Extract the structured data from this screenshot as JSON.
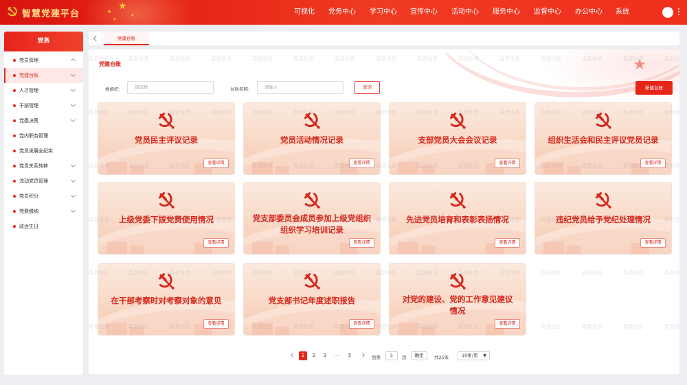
{
  "app": {
    "title": "智慧党建平台",
    "logo_icon": "hammer-sickle-icon",
    "brand_color": "#e7261a"
  },
  "nav": [
    "可视化",
    "党务中心",
    "学习中心",
    "宣传中心",
    "活动中心",
    "服务中心",
    "监督中心",
    "办公中心",
    "系统"
  ],
  "sidebar": {
    "header": "党务",
    "items": [
      {
        "label": "党员管理",
        "chevron": "up"
      },
      {
        "label": "党建台账",
        "chevron": "down",
        "active": true
      },
      {
        "label": "人才管理",
        "chevron": "down"
      },
      {
        "label": "干部管理",
        "chevron": "down"
      },
      {
        "label": "党委决策",
        "chevron": "down"
      },
      {
        "label": "党内职务管理",
        "chevron": ""
      },
      {
        "label": "党员发展全纪实",
        "chevron": ""
      },
      {
        "label": "党员关系转移",
        "chevron": "down"
      },
      {
        "label": "流动党员管理",
        "chevron": "down"
      },
      {
        "label": "党员积分",
        "chevron": "down"
      },
      {
        "label": "党费缴纳",
        "chevron": "down"
      },
      {
        "label": "政治生日",
        "chevron": ""
      }
    ]
  },
  "tabs": [
    {
      "label": "党建台账"
    }
  ],
  "main": {
    "title": "党建台账",
    "filter": {
      "org_label": "党组织:",
      "org_placeholder": "请选择",
      "name_label": "台账名称:",
      "name_placeholder": "请输入",
      "query_label": "查询",
      "new_label": "新建台账"
    }
  },
  "cards": {
    "view_label": "查看详情",
    "items": [
      {
        "title": [
          "党员民主评议记录"
        ]
      },
      {
        "title": [
          "党员活动情况记录"
        ]
      },
      {
        "title": [
          "支部党员大会会议记录"
        ]
      },
      {
        "title": [
          "组织生活会和民主评议党员记录"
        ]
      },
      {
        "title": [
          "上级党委下拨党费使用情况"
        ]
      },
      {
        "title": [
          "党支部委员会成员参加上级党组织",
          "组织学习培训记录"
        ]
      },
      {
        "title": [
          "先进党员培育和表彰表扬情况"
        ]
      },
      {
        "title": [
          "违纪党员给予党纪处理情况"
        ]
      },
      {
        "title": [
          "在干部考察时对考察对象的意见"
        ]
      },
      {
        "title": [
          "党支部书记年度述职报告"
        ]
      },
      {
        "title": [
          "对党的建设、党的工作意见建议",
          "情况"
        ]
      }
    ]
  },
  "pagination": {
    "pages": [
      "1",
      "2",
      "3",
      "···",
      "5"
    ],
    "current": "1",
    "goto_label": "到第",
    "goto_value": "5",
    "page_unit": "页",
    "confirm_label": "确定",
    "total": "共25条",
    "page_size": "10条/页"
  },
  "watermark": "森普信息"
}
